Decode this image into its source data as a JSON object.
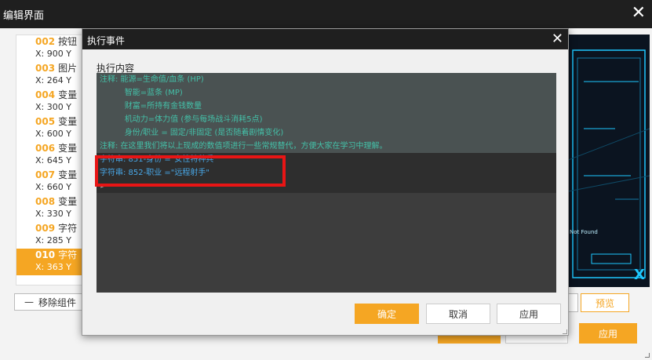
{
  "outer": {
    "title": "编辑界面",
    "close_glyph": "✕",
    "list_items": [
      {
        "num": "002",
        "name": "按钮",
        "sub": "X: 900   Y"
      },
      {
        "num": "003",
        "name": "图片",
        "sub": "X: 264   Y"
      },
      {
        "num": "004",
        "name": "变量",
        "sub": "X: 300   Y"
      },
      {
        "num": "005",
        "name": "变量",
        "sub": "X: 600   Y"
      },
      {
        "num": "006",
        "name": "变量",
        "sub": "X: 645   Y"
      },
      {
        "num": "007",
        "name": "变量",
        "sub": "X: 660   Y"
      },
      {
        "num": "008",
        "name": "变量",
        "sub": "X: 330   Y"
      },
      {
        "num": "009",
        "name": "字符",
        "sub": "X: 285   Y"
      },
      {
        "num": "010",
        "name": "字符",
        "sub": "X: 363   Y"
      }
    ],
    "selected_index": 8,
    "remove_label": "移除组件",
    "preview_label": "预览",
    "apply_label": "应用",
    "preview_notfound": "Not Found"
  },
  "modal": {
    "title": "执行事件",
    "close_glyph": "✕",
    "content_label": "执行内容",
    "lines": [
      {
        "kind": "comment",
        "text": "注释: 能源=生命值/血条 (HP)"
      },
      {
        "kind": "comment",
        "text": "          智能=蓝条 (MP)"
      },
      {
        "kind": "comment",
        "text": "          财富=所持有金钱数量"
      },
      {
        "kind": "comment",
        "text": "          机动力=体力值 (参与每场战斗消耗5点)"
      },
      {
        "kind": "comment",
        "text": "          身份/职业 = 固定/非固定 (是否随着剧情变化)"
      },
      {
        "kind": "comment",
        "text": "注释: 在这里我们将以上现成的数值项进行一些常规替代，方便大家在学习中理解。"
      },
      {
        "kind": "string",
        "text": "字符串: 851-身份 =\"女性特种兵\""
      },
      {
        "kind": "string",
        "text": "字符串: 852-职业 =\"远程射手\""
      },
      {
        "kind": "plain",
        "text": ">"
      }
    ],
    "ok_label": "确定",
    "cancel_label": "取消",
    "apply_label": "应用"
  },
  "colors": {
    "accent": "#f5a623",
    "highlight": "#e81515",
    "titlebar": "#1f1f1f",
    "comment_text": "#44c0a8",
    "string_text": "#48a8e8",
    "preview_cyan": "#1ec8ff"
  }
}
